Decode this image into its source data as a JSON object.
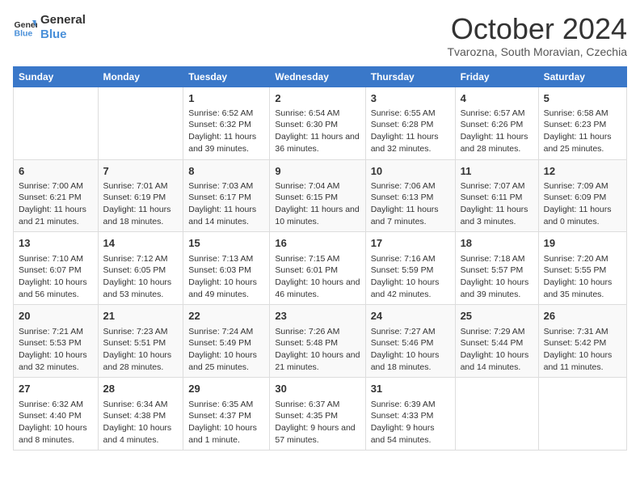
{
  "logo": {
    "line1": "General",
    "line2": "Blue"
  },
  "title": "October 2024",
  "subtitle": "Tvarozna, South Moravian, Czechia",
  "columns": [
    "Sunday",
    "Monday",
    "Tuesday",
    "Wednesday",
    "Thursday",
    "Friday",
    "Saturday"
  ],
  "weeks": [
    [
      {
        "day": "",
        "content": ""
      },
      {
        "day": "",
        "content": ""
      },
      {
        "day": "1",
        "content": "Sunrise: 6:52 AM\nSunset: 6:32 PM\nDaylight: 11 hours and 39 minutes."
      },
      {
        "day": "2",
        "content": "Sunrise: 6:54 AM\nSunset: 6:30 PM\nDaylight: 11 hours and 36 minutes."
      },
      {
        "day": "3",
        "content": "Sunrise: 6:55 AM\nSunset: 6:28 PM\nDaylight: 11 hours and 32 minutes."
      },
      {
        "day": "4",
        "content": "Sunrise: 6:57 AM\nSunset: 6:26 PM\nDaylight: 11 hours and 28 minutes."
      },
      {
        "day": "5",
        "content": "Sunrise: 6:58 AM\nSunset: 6:23 PM\nDaylight: 11 hours and 25 minutes."
      }
    ],
    [
      {
        "day": "6",
        "content": "Sunrise: 7:00 AM\nSunset: 6:21 PM\nDaylight: 11 hours and 21 minutes."
      },
      {
        "day": "7",
        "content": "Sunrise: 7:01 AM\nSunset: 6:19 PM\nDaylight: 11 hours and 18 minutes."
      },
      {
        "day": "8",
        "content": "Sunrise: 7:03 AM\nSunset: 6:17 PM\nDaylight: 11 hours and 14 minutes."
      },
      {
        "day": "9",
        "content": "Sunrise: 7:04 AM\nSunset: 6:15 PM\nDaylight: 11 hours and 10 minutes."
      },
      {
        "day": "10",
        "content": "Sunrise: 7:06 AM\nSunset: 6:13 PM\nDaylight: 11 hours and 7 minutes."
      },
      {
        "day": "11",
        "content": "Sunrise: 7:07 AM\nSunset: 6:11 PM\nDaylight: 11 hours and 3 minutes."
      },
      {
        "day": "12",
        "content": "Sunrise: 7:09 AM\nSunset: 6:09 PM\nDaylight: 11 hours and 0 minutes."
      }
    ],
    [
      {
        "day": "13",
        "content": "Sunrise: 7:10 AM\nSunset: 6:07 PM\nDaylight: 10 hours and 56 minutes."
      },
      {
        "day": "14",
        "content": "Sunrise: 7:12 AM\nSunset: 6:05 PM\nDaylight: 10 hours and 53 minutes."
      },
      {
        "day": "15",
        "content": "Sunrise: 7:13 AM\nSunset: 6:03 PM\nDaylight: 10 hours and 49 minutes."
      },
      {
        "day": "16",
        "content": "Sunrise: 7:15 AM\nSunset: 6:01 PM\nDaylight: 10 hours and 46 minutes."
      },
      {
        "day": "17",
        "content": "Sunrise: 7:16 AM\nSunset: 5:59 PM\nDaylight: 10 hours and 42 minutes."
      },
      {
        "day": "18",
        "content": "Sunrise: 7:18 AM\nSunset: 5:57 PM\nDaylight: 10 hours and 39 minutes."
      },
      {
        "day": "19",
        "content": "Sunrise: 7:20 AM\nSunset: 5:55 PM\nDaylight: 10 hours and 35 minutes."
      }
    ],
    [
      {
        "day": "20",
        "content": "Sunrise: 7:21 AM\nSunset: 5:53 PM\nDaylight: 10 hours and 32 minutes."
      },
      {
        "day": "21",
        "content": "Sunrise: 7:23 AM\nSunset: 5:51 PM\nDaylight: 10 hours and 28 minutes."
      },
      {
        "day": "22",
        "content": "Sunrise: 7:24 AM\nSunset: 5:49 PM\nDaylight: 10 hours and 25 minutes."
      },
      {
        "day": "23",
        "content": "Sunrise: 7:26 AM\nSunset: 5:48 PM\nDaylight: 10 hours and 21 minutes."
      },
      {
        "day": "24",
        "content": "Sunrise: 7:27 AM\nSunset: 5:46 PM\nDaylight: 10 hours and 18 minutes."
      },
      {
        "day": "25",
        "content": "Sunrise: 7:29 AM\nSunset: 5:44 PM\nDaylight: 10 hours and 14 minutes."
      },
      {
        "day": "26",
        "content": "Sunrise: 7:31 AM\nSunset: 5:42 PM\nDaylight: 10 hours and 11 minutes."
      }
    ],
    [
      {
        "day": "27",
        "content": "Sunrise: 6:32 AM\nSunset: 4:40 PM\nDaylight: 10 hours and 8 minutes."
      },
      {
        "day": "28",
        "content": "Sunrise: 6:34 AM\nSunset: 4:38 PM\nDaylight: 10 hours and 4 minutes."
      },
      {
        "day": "29",
        "content": "Sunrise: 6:35 AM\nSunset: 4:37 PM\nDaylight: 10 hours and 1 minute."
      },
      {
        "day": "30",
        "content": "Sunrise: 6:37 AM\nSunset: 4:35 PM\nDaylight: 9 hours and 57 minutes."
      },
      {
        "day": "31",
        "content": "Sunrise: 6:39 AM\nSunset: 4:33 PM\nDaylight: 9 hours and 54 minutes."
      },
      {
        "day": "",
        "content": ""
      },
      {
        "day": "",
        "content": ""
      }
    ]
  ]
}
